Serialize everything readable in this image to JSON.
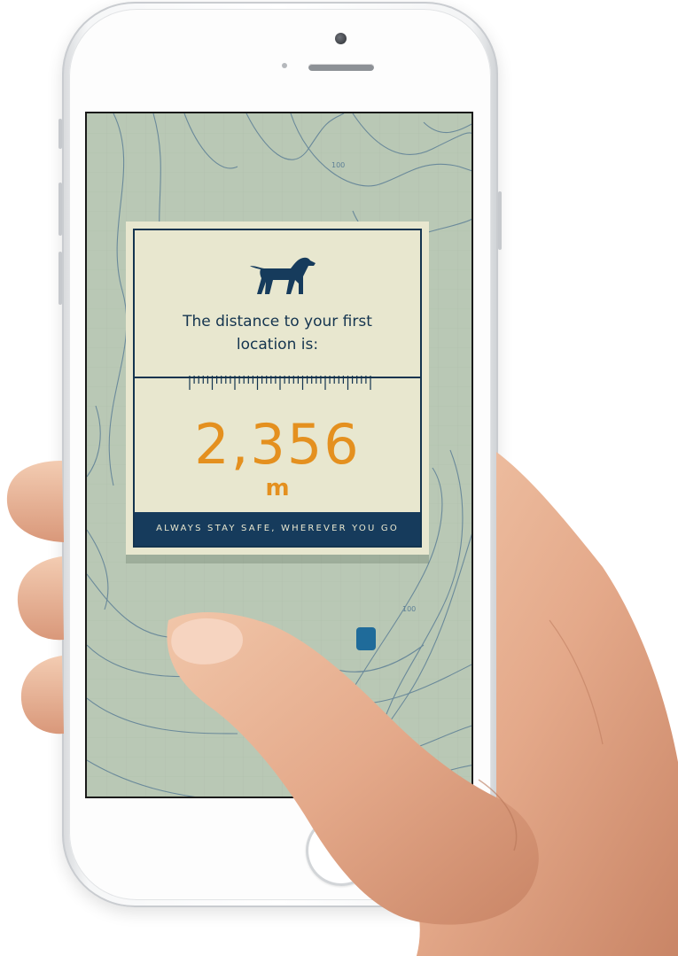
{
  "map": {
    "contour_labels": [
      "100",
      "100"
    ]
  },
  "card": {
    "icon": "dog-icon",
    "message": "The distance to your first location is:",
    "message_line1": "The distance to your first",
    "message_line2": "location is:",
    "distance_value": "2,356",
    "distance_unit": "m",
    "banner_text": "ALWAYS STAY SAFE, WHEREVER YOU GO"
  },
  "colors": {
    "map_background": "#b9c8b5",
    "card_background": "#e8e7cf",
    "navy": "#14344f",
    "accent_orange": "#e4901f"
  }
}
